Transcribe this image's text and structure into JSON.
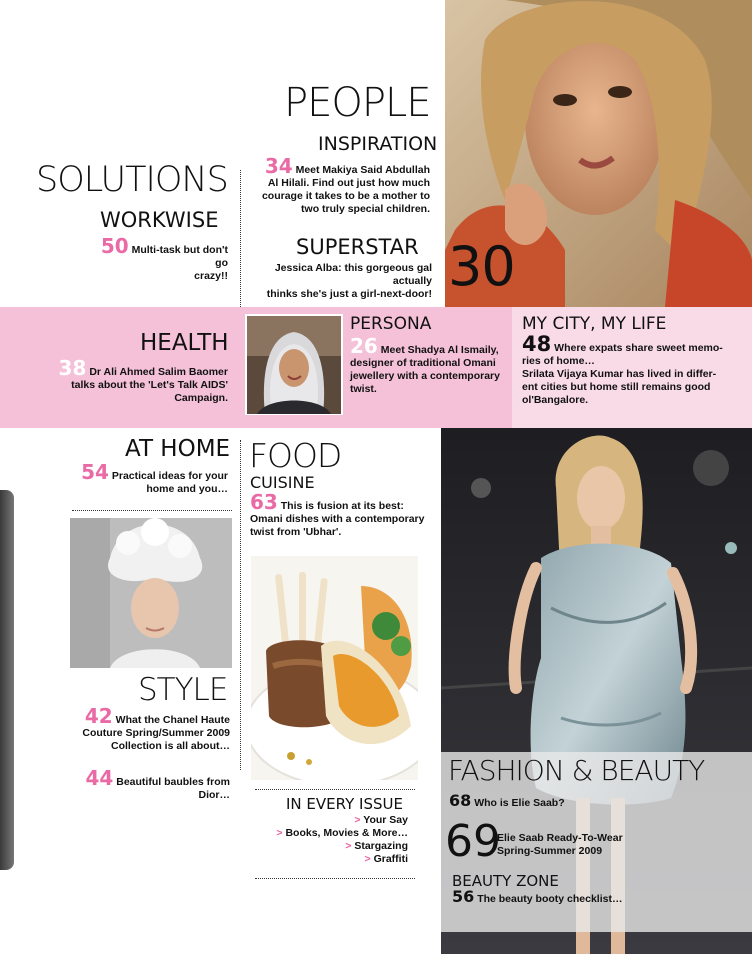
{
  "people": {
    "title": "PEOPLE",
    "inspiration": {
      "heading": "INSPIRATION",
      "page": "34",
      "text_lines": [
        "Meet Makiya Said Abdullah",
        "Al Hilali. Find out just how much",
        "courage it takes to be a mother to",
        "two truly special children."
      ]
    },
    "superstar": {
      "heading": "SUPERSTAR",
      "text_lines": [
        "Jessica Alba: this gorgeous gal actually",
        "thinks she's just a girl-next-door!"
      ],
      "page": "30"
    }
  },
  "solutions": {
    "title": "SOLUTIONS",
    "workwise": {
      "heading": "WORKWISE",
      "page": "50",
      "text_lines": [
        "Multi-task but don't go",
        "crazy!!"
      ]
    }
  },
  "health": {
    "heading": "HEALTH",
    "page": "38",
    "text_lines": [
      "Dr Ali Ahmed Salim Baomer",
      "talks about the 'Let's Talk AIDS'",
      "Campaign."
    ]
  },
  "persona": {
    "heading": "PERSONA",
    "page": "26",
    "text_lines": [
      "Meet Shadya Al Ismaily,",
      "designer of traditional Omani",
      "jewellery with a contemporary",
      "twist."
    ]
  },
  "my_city": {
    "heading": "MY CITY, MY LIFE",
    "page": "48",
    "text_lines": [
      "Where expats share sweet memo-",
      "ries of home…",
      "Srilata Vijaya Kumar has lived in differ-",
      "ent cities but home still remains good",
      "ol'Bangalore."
    ]
  },
  "at_home": {
    "heading": "AT HOME",
    "page": "54",
    "text_lines": [
      "Practical ideas for your",
      "home and you…"
    ]
  },
  "food": {
    "title": "FOOD",
    "heading": "CUISINE",
    "page": "63",
    "text_lines": [
      "This is fusion at its best:",
      "Omani dishes with a contemporary",
      "twist from 'Ubhar'."
    ]
  },
  "style": {
    "title": "STYLE",
    "items": [
      {
        "page": "42",
        "text_lines": [
          "What the Chanel Haute",
          "Couture Spring/Summer 2009",
          "Collection is all about…"
        ]
      },
      {
        "page": "44",
        "text_lines": [
          "Beautiful baubles from",
          "Dior…"
        ]
      }
    ]
  },
  "in_every_issue": {
    "heading": "IN EVERY ISSUE",
    "items": [
      "Your Say",
      "Books, Movies & More…",
      "Stargazing",
      "Graffiti"
    ],
    "marker": ">"
  },
  "fashion_beauty": {
    "title": "FASHION & BEAUTY",
    "items": [
      {
        "page": "68",
        "text": "Who is Elie Saab?"
      },
      {
        "page": "69",
        "text_lines": [
          "Elie Saab Ready-To-Wear",
          "Spring-Summer 2009"
        ]
      }
    ],
    "beauty_zone": {
      "heading": "BEAUTY ZONE",
      "page": "56",
      "text": "The beauty booty checklist…"
    }
  },
  "colors": {
    "pink_band": "#f4c1d8",
    "pink_light": "#f9dbe8",
    "accent_pink": "#e8609e"
  }
}
